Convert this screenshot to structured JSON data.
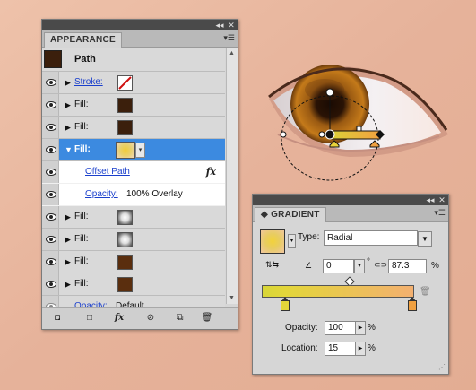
{
  "colors": {
    "skin": "#e8b8a0",
    "selection": "#3c8ae0",
    "link": "#1a3fcc",
    "fill_swatch": "#3b1f0c",
    "gradient_start": "#d8d638",
    "gradient_end": "#f3b070"
  },
  "appearance": {
    "tab_label": "APPEARANCE",
    "object_label": "Path",
    "rows": [
      {
        "type": "stroke",
        "label": "Stroke:",
        "link": true
      },
      {
        "type": "fill",
        "label": "Fill:",
        "swatch": "dark-brown"
      },
      {
        "type": "fill",
        "label": "Fill:",
        "swatch": "dark-brown"
      },
      {
        "type": "fill",
        "label": "Fill:",
        "swatch": "gradient",
        "selected": true
      },
      {
        "type": "effect",
        "label": "Offset Path",
        "fx": "fx"
      },
      {
        "type": "opacity",
        "label": "Opacity:",
        "value": "100% Overlay"
      },
      {
        "type": "fill",
        "label": "Fill:",
        "swatch": "radial-pattern"
      },
      {
        "type": "fill",
        "label": "Fill:",
        "swatch": "radial-pattern"
      },
      {
        "type": "fill",
        "label": "Fill:",
        "swatch": "brown"
      },
      {
        "type": "fill",
        "label": "Fill:",
        "swatch": "brown"
      },
      {
        "type": "opacity",
        "label": "Opacity:",
        "value": "Default"
      }
    ],
    "footer_icons": [
      "new-art-basic-icon",
      "clear-appearance-icon",
      "add-effect-icon",
      "reduce-icon",
      "duplicate-icon",
      "trash-icon"
    ],
    "fx_footer": "fx"
  },
  "gradient": {
    "tab_label": "GRADIENT",
    "type_label": "Type:",
    "type_value": "Radial",
    "angle_value": "0",
    "angle_unit": "°",
    "aspect_value": "87.3",
    "aspect_unit": "%",
    "opacity_label": "Opacity:",
    "opacity_value": "100",
    "opacity_unit": "%",
    "location_label": "Location:",
    "location_value": "15",
    "location_unit": "%"
  }
}
